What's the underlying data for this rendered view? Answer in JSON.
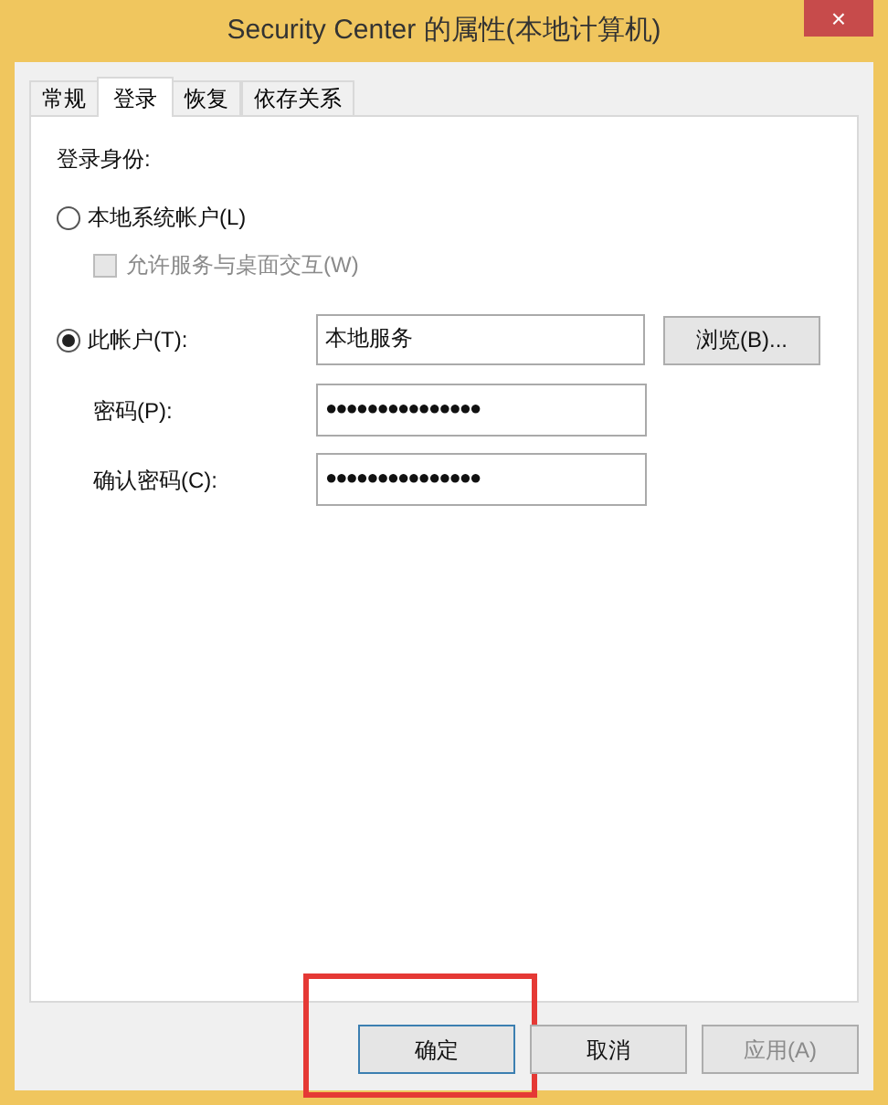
{
  "window": {
    "title": "Security Center 的属性(本地计算机)",
    "close": "×"
  },
  "tabs": [
    {
      "label": "常规",
      "selected": false
    },
    {
      "label": "登录",
      "selected": true
    },
    {
      "label": "恢复",
      "selected": false
    },
    {
      "label": "依存关系",
      "selected": false
    }
  ],
  "logon": {
    "heading": "登录身份:",
    "local_system": {
      "label": "本地系统帐户(L)",
      "selected": false
    },
    "interact": {
      "label": "允许服务与桌面交互(W)",
      "checked": false,
      "disabled": true
    },
    "this_account": {
      "label": "此帐户(T):",
      "selected": true,
      "value": "本地服务",
      "browse": "浏览(B)..."
    },
    "password": {
      "label": "密码(P):",
      "value": "●●●●●●●●●●●●●●●"
    },
    "confirm": {
      "label": "确认密码(C):",
      "value": "●●●●●●●●●●●●●●●"
    }
  },
  "buttons": [
    {
      "label": "确定",
      "default": true,
      "highlighted": true,
      "disabled": false
    },
    {
      "label": "取消",
      "default": false,
      "highlighted": false,
      "disabled": false
    },
    {
      "label": "应用(A)",
      "default": false,
      "highlighted": false,
      "disabled": true
    }
  ]
}
